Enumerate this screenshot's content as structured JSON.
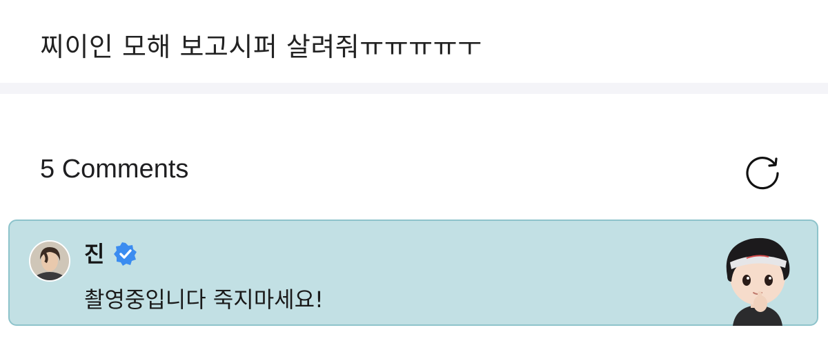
{
  "post": {
    "text": "찌이인 모해 보고시퍼 살려줘ㅠㅠㅠㅠㅜ"
  },
  "comments": {
    "count_label": "5 Comments",
    "refresh_icon": "refresh-icon",
    "items": [
      {
        "author": "진",
        "verified": true,
        "verified_color": "#3b8cf0",
        "text": "촬영중입니다 죽지마세요!",
        "card_color": "#c2e0e4",
        "sticker": "character-sticker"
      }
    ]
  }
}
